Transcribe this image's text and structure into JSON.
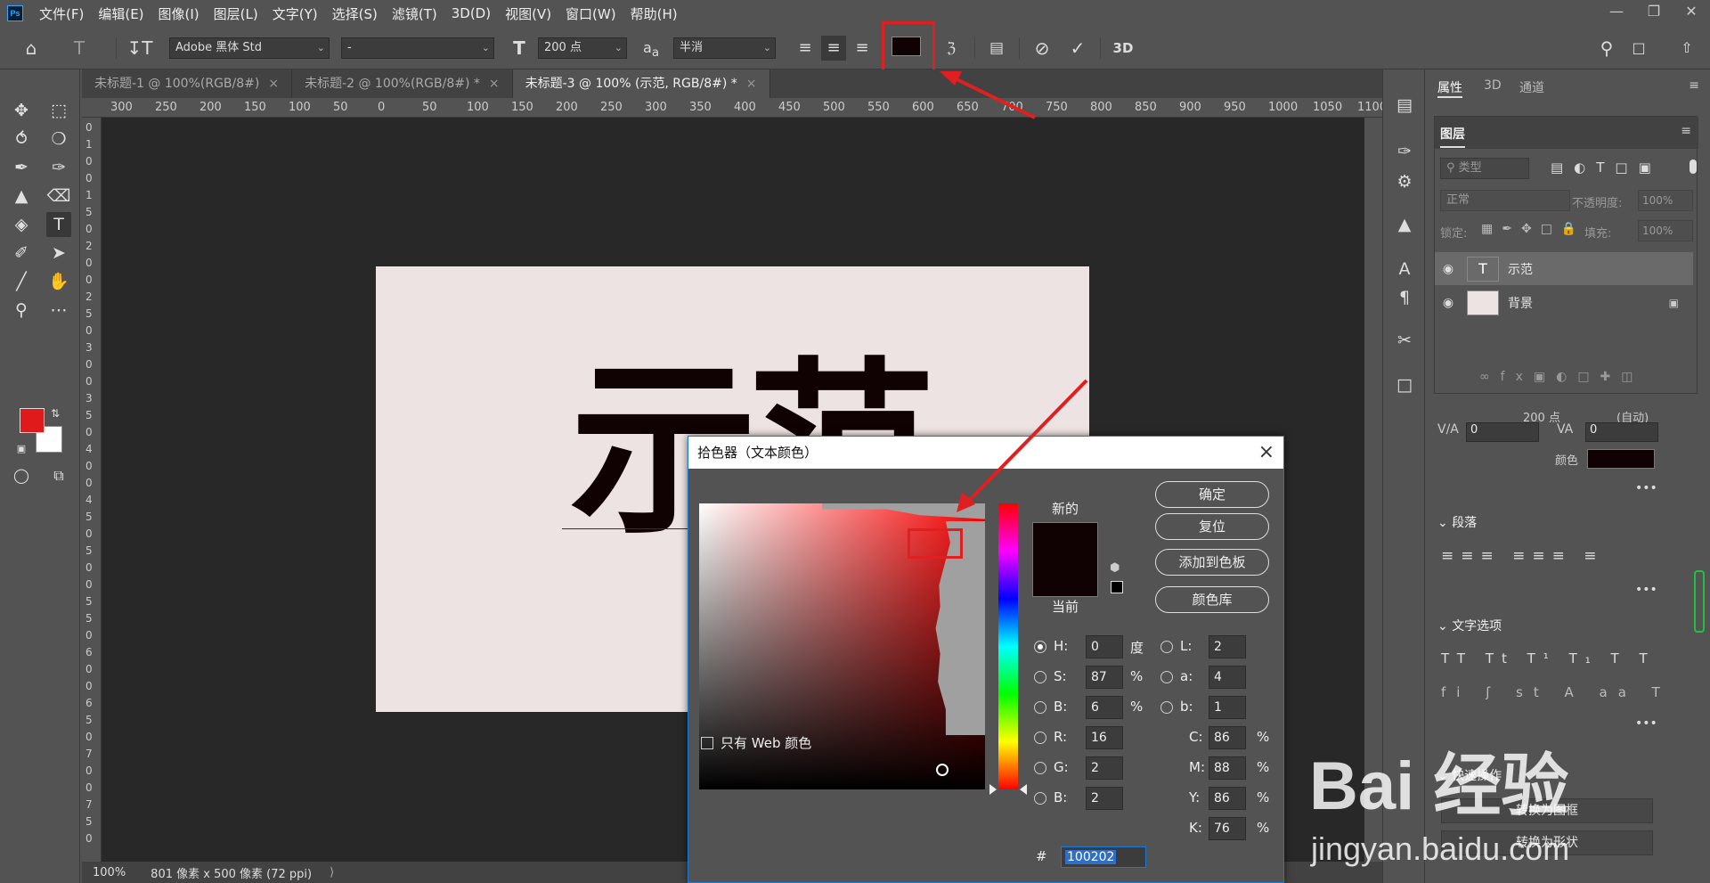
{
  "menubar": {
    "logo": "Ps",
    "items": [
      "文件(F)",
      "编辑(E)",
      "图像(I)",
      "图层(L)",
      "文字(Y)",
      "选择(S)",
      "滤镜(T)",
      "3D(D)",
      "视图(V)",
      "窗口(W)",
      "帮助(H)"
    ]
  },
  "options": {
    "font_family": "Adobe 黑体 Std",
    "font_style": "-",
    "font_size": "200 点",
    "antialias": "半消",
    "mode_3d": "3D",
    "text_color": "#100202"
  },
  "tabs": [
    {
      "label": "未标题-1 @ 100%(RGB/8#)"
    },
    {
      "label": "未标题-2 @ 100%(RGB/8#) *"
    },
    {
      "label": "未标题-3 @ 100% (示范, RGB/8#) *"
    }
  ],
  "ruler": {
    "h_labels": [
      "300",
      "250",
      "200",
      "150",
      "100",
      "50",
      "0",
      "50",
      "100",
      "150",
      "200",
      "250",
      "300",
      "350",
      "400",
      "450",
      "500",
      "550",
      "600",
      "650",
      "700",
      "750",
      "800",
      "850",
      "900",
      "950",
      "1000",
      "1050",
      "1100"
    ],
    "v_labels": [
      "0",
      "1",
      "0",
      "0",
      "1",
      "5",
      "0",
      "2",
      "0",
      "0",
      "2",
      "5",
      "0",
      "3",
      "0",
      "0",
      "3",
      "5",
      "0",
      "4",
      "0",
      "0",
      "4",
      "5",
      "0",
      "5",
      "0",
      "0",
      "5",
      "5",
      "0",
      "6",
      "0",
      "0",
      "6",
      "5",
      "0",
      "7",
      "0",
      "0",
      "7",
      "5",
      "0"
    ]
  },
  "canvas": {
    "text": "示范"
  },
  "status": {
    "zoom": "100%",
    "doc_size": "801 像素 x 500 像素 (72 ppi)"
  },
  "right_panel": {
    "tabs": [
      "属性",
      "3D",
      "通道"
    ],
    "layers_title": "图层",
    "filter_kind": "类型",
    "blend_mode": "正常",
    "opacity_label": "不透明度:",
    "opacity_value": "100%",
    "lock_label": "锁定:",
    "fill_label": "填充:",
    "fill_value": "100%",
    "layers": [
      {
        "name": "示范",
        "thumb": "T"
      },
      {
        "name": "背景",
        "thumb": ""
      }
    ],
    "char": {
      "size": "200 点",
      "leading": "(自动)",
      "kerning": "0",
      "tracking": "0",
      "color_label": "颜色"
    },
    "paragraph_title": "段落",
    "text_options_title": "文字选项",
    "quick_actions_title": "快速操作",
    "convert_frame": "转换为图框",
    "convert_shape": "转换为形状"
  },
  "dialog": {
    "title": "拾色器（文本颜色）",
    "new_label": "新的",
    "current_label": "当前",
    "buttons": {
      "ok": "确定",
      "reset": "复位",
      "add_swatch": "添加到色板",
      "library": "颜色库"
    },
    "web_only": "只有 Web 颜色",
    "hsb": [
      {
        "label": "H:",
        "value": "0",
        "unit": "度"
      },
      {
        "label": "S:",
        "value": "87",
        "unit": "%"
      },
      {
        "label": "B:",
        "value": "6",
        "unit": "%"
      }
    ],
    "rgb": [
      {
        "label": "R:",
        "value": "16"
      },
      {
        "label": "G:",
        "value": "2"
      },
      {
        "label": "B:",
        "value": "2"
      }
    ],
    "lab": [
      {
        "label": "L:",
        "value": "2"
      },
      {
        "label": "a:",
        "value": "4"
      },
      {
        "label": "b:",
        "value": "1"
      }
    ],
    "cmyk": [
      {
        "label": "C:",
        "value": "86",
        "unit": "%"
      },
      {
        "label": "M:",
        "value": "88",
        "unit": "%"
      },
      {
        "label": "Y:",
        "value": "86",
        "unit": "%"
      },
      {
        "label": "K:",
        "value": "76",
        "unit": "%"
      }
    ],
    "hex_label": "#",
    "hex_value": "100202"
  },
  "watermark": {
    "brand": "Bai 经验",
    "url": "jingyan.baidu.com"
  }
}
